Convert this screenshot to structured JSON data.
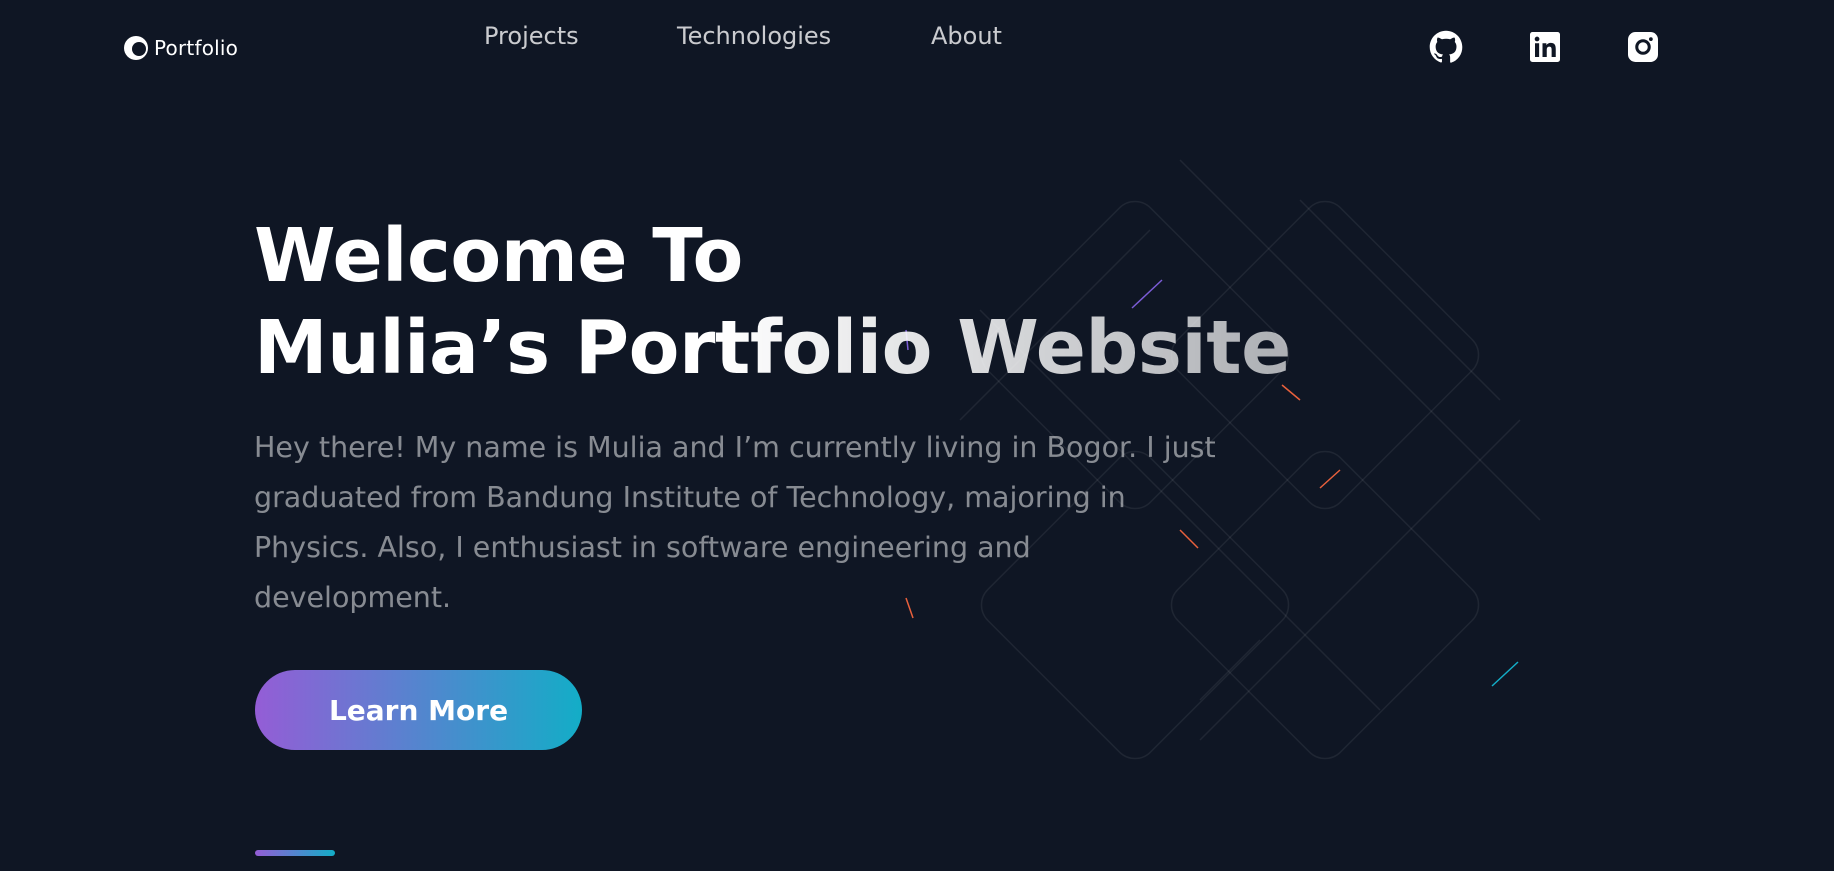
{
  "header": {
    "logo_text": "Portfolio",
    "nav": [
      {
        "label": "Projects"
      },
      {
        "label": "Technologies"
      },
      {
        "label": "About"
      }
    ],
    "social": [
      {
        "icon": "github-icon"
      },
      {
        "icon": "linkedin-icon"
      },
      {
        "icon": "instagram-icon"
      }
    ]
  },
  "hero": {
    "title_line1": "Welcome To",
    "title_line2": "Mulia’s Portfolio Website",
    "description": "Hey there! My name is Mulia and I’m currently living in Bogor. I just graduated from Bandung Institute of Technology, majoring in Physics. Also, I enthusiast in software engineering and development.",
    "cta_label": "Learn More"
  },
  "colors": {
    "background": "#0f1624",
    "gradient_start": "#945dd6",
    "gradient_mid": "#6978d1",
    "gradient_end": "#13adc7"
  }
}
